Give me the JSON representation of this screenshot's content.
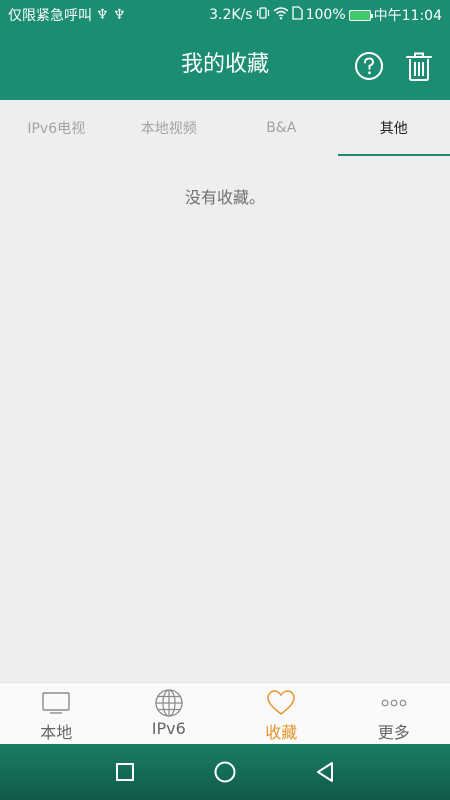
{
  "status_bar": {
    "left_text": "仅限紧急呼叫",
    "usb_icons": "♆ ♆",
    "speed": "3.2K/s",
    "battery_pct": "100%",
    "time": "中午11:04"
  },
  "app_bar": {
    "title": "我的收藏"
  },
  "tabs": [
    {
      "label": "IPv6电视",
      "active": false
    },
    {
      "label": "本地视频",
      "active": false
    },
    {
      "label": "B&A",
      "active": false
    },
    {
      "label": "其他",
      "active": true
    }
  ],
  "content": {
    "empty_message": "没有收藏。"
  },
  "bottom_nav": [
    {
      "label": "本地",
      "icon": "tv-icon",
      "active": false
    },
    {
      "label": "IPv6",
      "icon": "globe-icon",
      "active": false
    },
    {
      "label": "收藏",
      "icon": "heart-icon",
      "active": true
    },
    {
      "label": "更多",
      "icon": "more-icon",
      "active": false
    }
  ],
  "colors": {
    "primary": "#1a8d72",
    "accent": "#e8942c",
    "background": "#efedf0"
  }
}
